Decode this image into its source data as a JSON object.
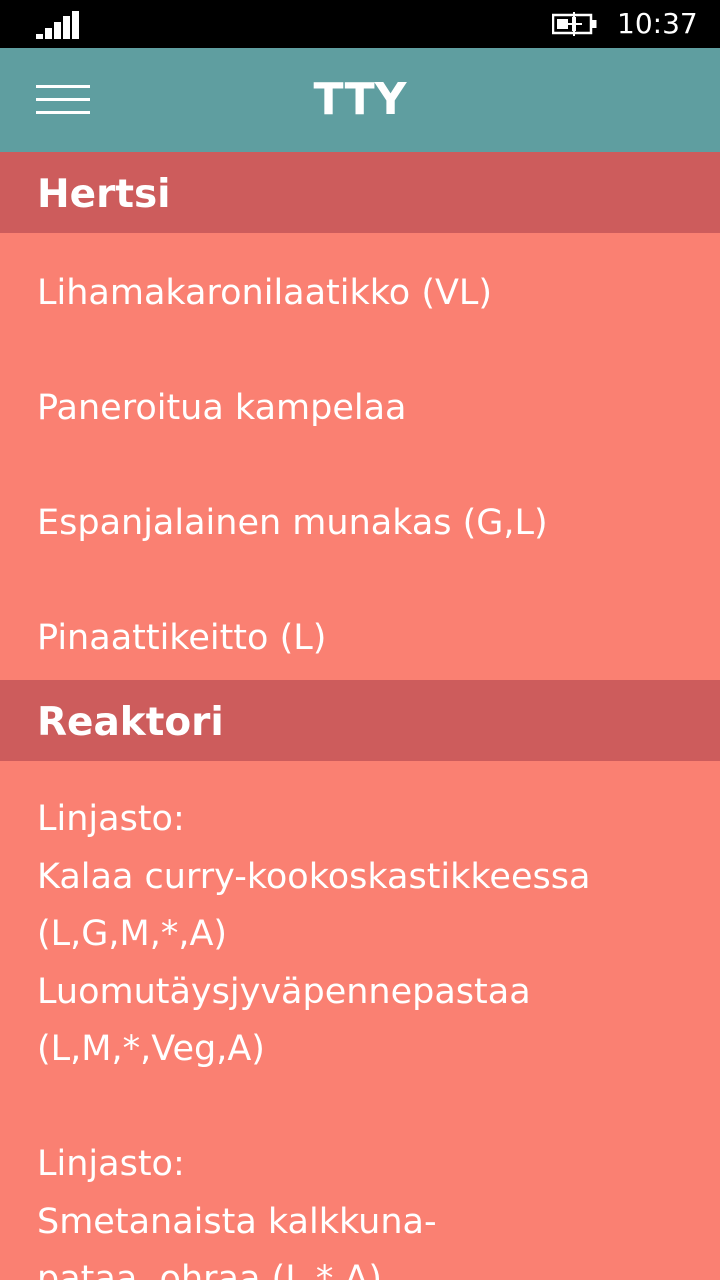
{
  "status_bar": {
    "signal": "signal-strength-icon",
    "battery": "battery-charging-icon",
    "time": "10:37"
  },
  "app_bar": {
    "menu_icon": "hamburger-menu-icon",
    "title": "TTY"
  },
  "restaurants": [
    {
      "name": "Hertsi",
      "items": [
        "Lihamakaronilaatikko (VL)",
        "Paneroitua kampelaa",
        "Espanjalainen munakas (G,L)",
        "Pinaattikeitto (L)"
      ]
    },
    {
      "name": "Reaktori",
      "text": "Linjasto:\nKalaa curry-kookoskastikkeessa\n(L,G,M,*,A)\nLuomutäysjyväpennepastaa\n(L,M,*,Veg,A)\n\nLinjasto:\nSmetanaista kalkkuna-\npataa, ohraa (L,*,A)"
    }
  ],
  "colors": {
    "status_bar_bg": "#000000",
    "app_bar_bg": "#5f9ea0",
    "section_header_bg": "#cd5c5c",
    "content_bg": "#fa8072",
    "text": "#ffffff"
  }
}
